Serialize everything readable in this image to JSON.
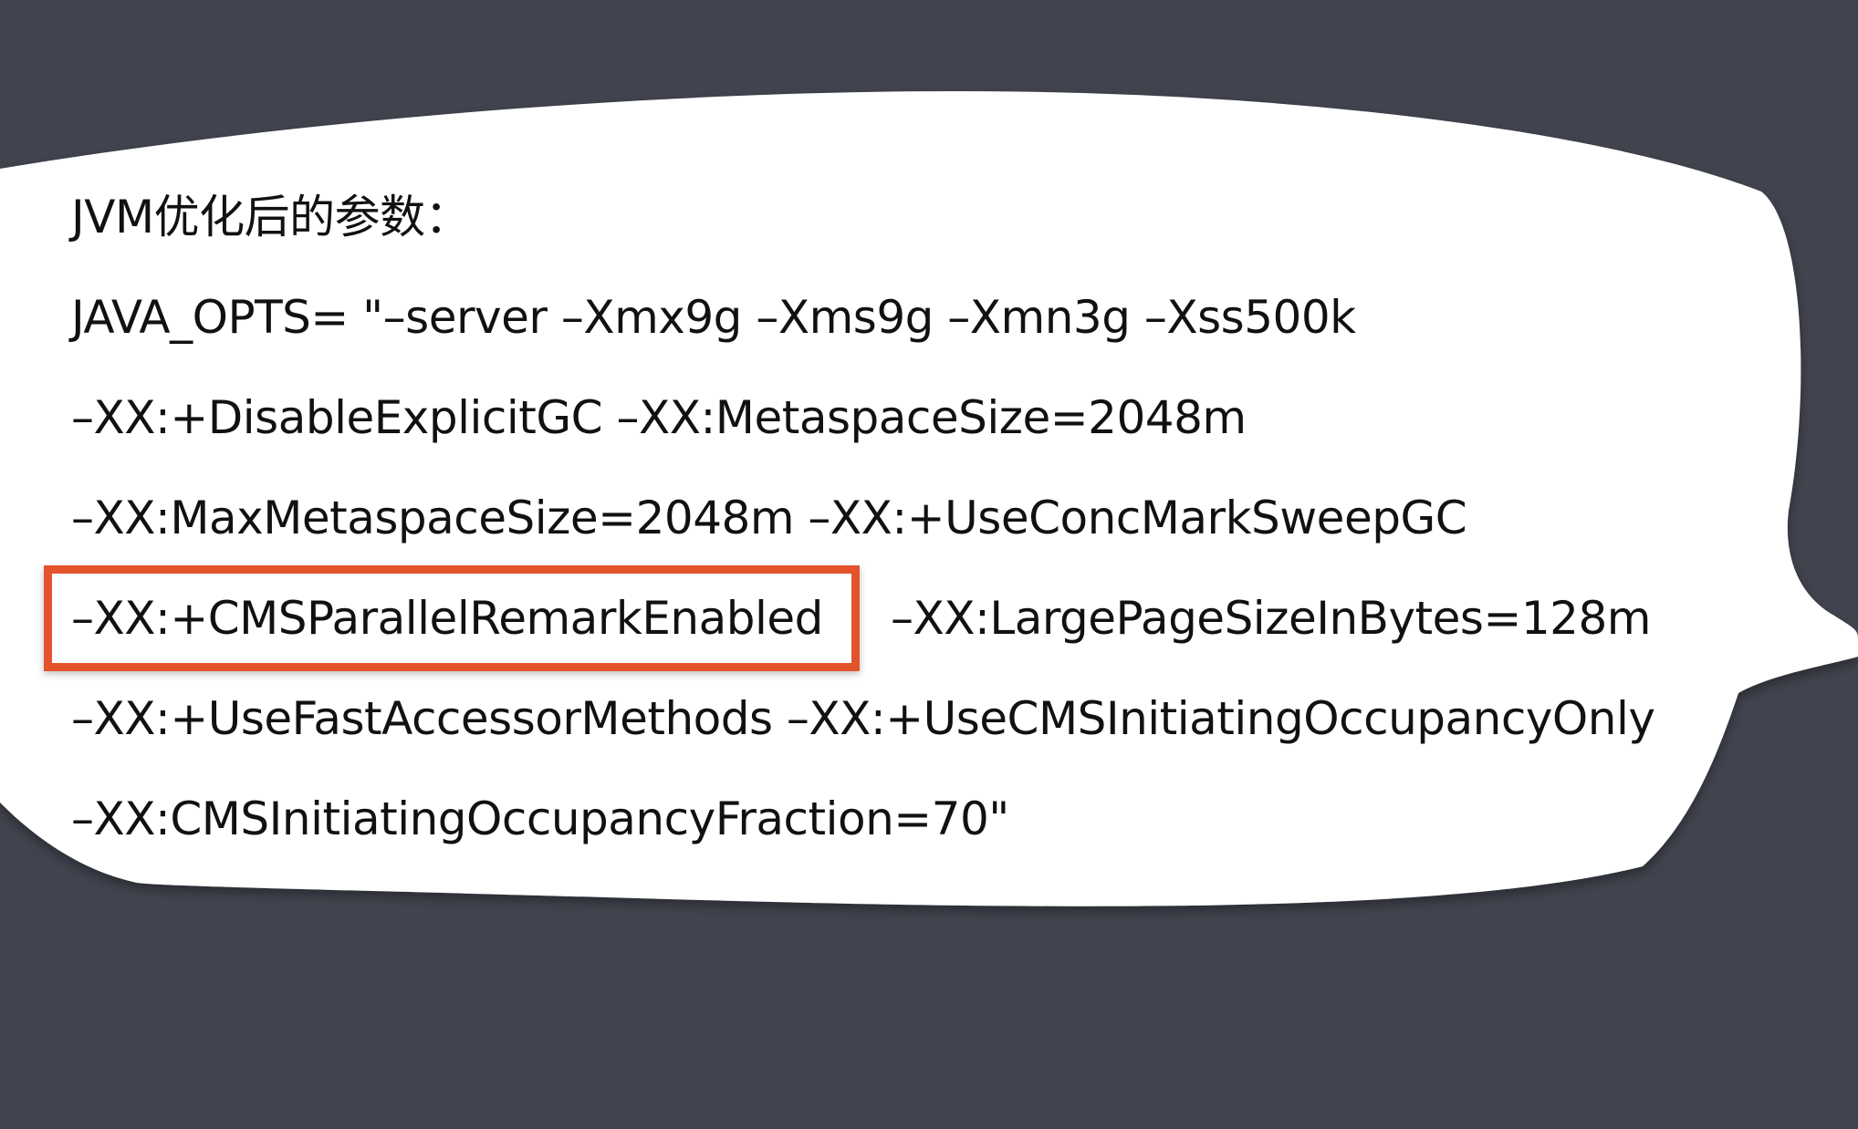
{
  "heading": "JVM优化后的参数：",
  "lines": [
    "JAVA_OPTS= \"–server –Xmx9g –Xms9g –Xmn3g –Xss500k",
    "–XX:+DisableExplicitGC –XX:MetaspaceSize=2048m",
    "–XX:MaxMetaspaceSize=2048m –XX:+UseConcMarkSweepGC",
    "–XX:+UseFastAccessorMethods –XX:+UseCMSInitiatingOccupancyOnly",
    "–XX:CMSInitiatingOccupancyFraction=70\""
  ],
  "highlighted_flag": "–XX:+CMSParallelRemarkEnabled",
  "flag_after_highlight": "–XX:LargePageSizeInBytes=128m",
  "colors": {
    "background": "#41434e",
    "bubble": "#ffffff",
    "highlight_border": "#e5532d",
    "text": "#111111"
  }
}
